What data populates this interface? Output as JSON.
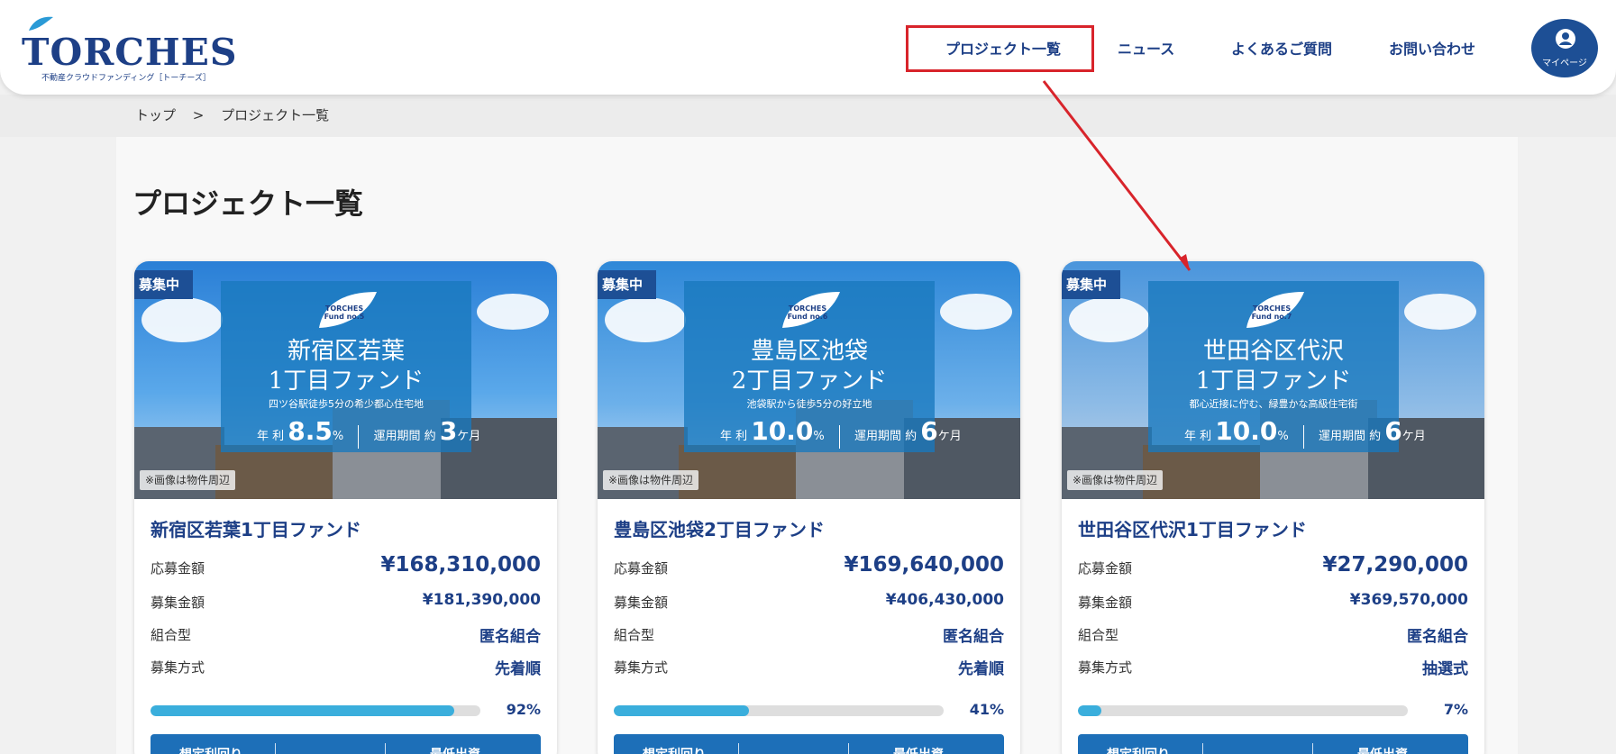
{
  "header": {
    "logo_text": "TORCHES",
    "logo_sub": "不動産クラウドファンディング［トーチーズ］",
    "nav": [
      "プロジェクト一覧",
      "ニュース",
      "よくあるご質問",
      "お問い合わせ"
    ],
    "mypage_label": "マイページ"
  },
  "breadcrumb": {
    "home": "トップ",
    "sep": ">",
    "current": "プロジェクト一覧"
  },
  "page_title": "プロジェクト一覧",
  "cards": [
    {
      "status": "募集中",
      "badge": "TORCHES Fund no.5",
      "overlay_title_1": "新宿区若葉",
      "overlay_title_2": "1丁目ファンド",
      "overlay_desc": "四ツ谷駅徒歩5分の希少都心住宅地",
      "overlay_rate_label": "年 利",
      "overlay_rate": "8.5",
      "overlay_rate_unit": "%",
      "overlay_period_label": "運用期間 約",
      "overlay_period": "3",
      "overlay_period_unit": "ケ月",
      "image_note": "※画像は物件周辺",
      "name": "新宿区若葉1丁目ファンド",
      "applied_label": "応募金額",
      "applied": "¥168,310,000",
      "target_label": "募集金額",
      "target": "¥181,390,000",
      "type_label": "組合型",
      "type": "匿名組合",
      "method_label": "募集方式",
      "method": "先着順",
      "progress": 92,
      "progress_label": "92%",
      "foot_left": "想定利回り",
      "foot_right": "最低出資"
    },
    {
      "status": "募集中",
      "badge": "TORCHES Fund no.6",
      "overlay_title_1": "豊島区池袋",
      "overlay_title_2": "2丁目ファンド",
      "overlay_desc": "池袋駅から徒歩5分の好立地",
      "overlay_rate_label": "年 利",
      "overlay_rate": "10.0",
      "overlay_rate_unit": "%",
      "overlay_period_label": "運用期間 約",
      "overlay_period": "6",
      "overlay_period_unit": "ケ月",
      "image_note": "※画像は物件周辺",
      "name": "豊島区池袋2丁目ファンド",
      "applied_label": "応募金額",
      "applied": "¥169,640,000",
      "target_label": "募集金額",
      "target": "¥406,430,000",
      "type_label": "組合型",
      "type": "匿名組合",
      "method_label": "募集方式",
      "method": "先着順",
      "progress": 41,
      "progress_label": "41%",
      "foot_left": "想定利回り",
      "foot_right": "最低出資"
    },
    {
      "status": "募集中",
      "badge": "TORCHES Fund no.7",
      "overlay_title_1": "世田谷区代沢",
      "overlay_title_2": "1丁目ファンド",
      "overlay_desc": "都心近接に佇む、緑豊かな高級住宅街",
      "overlay_rate_label": "年 利",
      "overlay_rate": "10.0",
      "overlay_rate_unit": "%",
      "overlay_period_label": "運用期間 約",
      "overlay_period": "6",
      "overlay_period_unit": "ケ月",
      "image_note": "※画像は物件周辺",
      "name": "世田谷区代沢1丁目ファンド",
      "applied_label": "応募金額",
      "applied": "¥27,290,000",
      "target_label": "募集金額",
      "target": "¥369,570,000",
      "type_label": "組合型",
      "type": "匿名組合",
      "method_label": "募集方式",
      "method": "抽選式",
      "progress": 7,
      "progress_label": "7%",
      "foot_left": "想定利回り",
      "foot_right": "最低出資"
    }
  ],
  "colors": {
    "brand": "#1d3f86",
    "accent": "#3aaedc",
    "highlight": "#d8242b"
  }
}
